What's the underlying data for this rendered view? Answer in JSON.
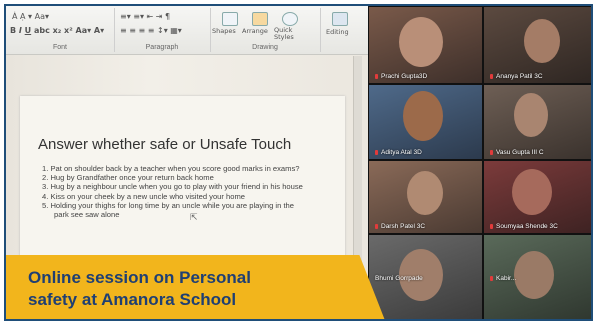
{
  "document": {
    "ribbon": {
      "font_group_label": "Font",
      "paragraph_group_label": "Paragraph",
      "drawing_group_label": "Drawing",
      "editing_label": "Editing",
      "shapes_label": "Shapes",
      "arrange_label": "Arrange",
      "quick_styles_label": "Quick Styles"
    },
    "title": "Answer whether safe or Unsafe Touch",
    "items": [
      "1.  Pat on shoulder back by a teacher when you score good marks in exams?",
      "2.  Hug by Grandfather once your return back home",
      "3.  Hug by a neighbour uncle when you go to play with your friend in his house",
      "4.  Kiss on your cheek by a new uncle who visited your home",
      "5.  Holding your thighs for long time by an uncle while you are playing in the"
    ],
    "item5_continuation": "park see saw alone"
  },
  "participants": [
    {
      "name": "Prachi Gupta3D"
    },
    {
      "name": "Ananya Patil 3C"
    },
    {
      "name": "Aditya Atal 3D"
    },
    {
      "name": "Vasu Gupta III C"
    },
    {
      "name": "Darsh Patel 3C"
    },
    {
      "name": "Soumyaa Shende 3C"
    },
    {
      "name": "Bhumi Gorrpade"
    },
    {
      "name": "Kabir..."
    }
  ],
  "banner": {
    "line1": "Online session on Personal",
    "line2": "safety at Amanora School",
    "background_color": "#f2b51c",
    "text_color": "#1f3f73"
  },
  "frame_color": "#1f4e79"
}
